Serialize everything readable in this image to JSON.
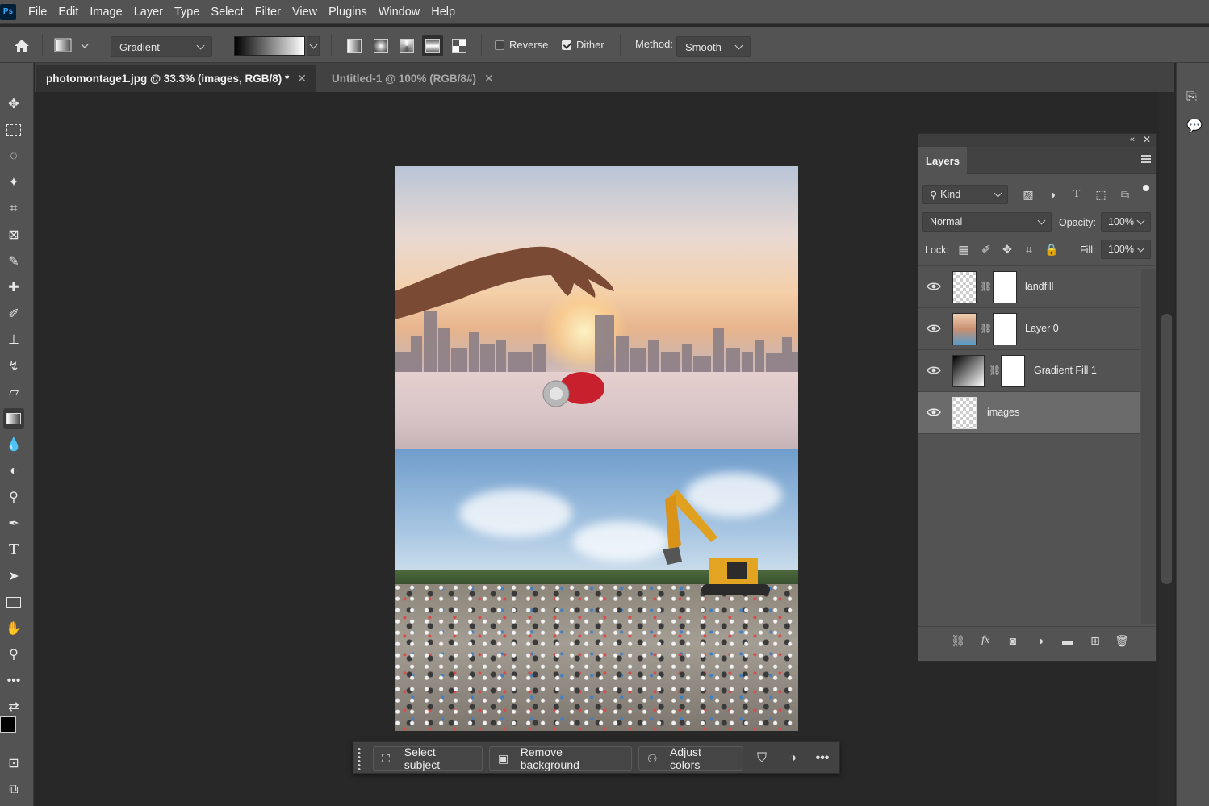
{
  "menubar": {
    "logo": "Ps",
    "items": [
      "File",
      "Edit",
      "Image",
      "Layer",
      "Type",
      "Select",
      "Filter",
      "View",
      "Plugins",
      "Window",
      "Help"
    ]
  },
  "options": {
    "preset_label": "Gradient",
    "reverse_label": "Reverse",
    "reverse_checked": false,
    "dither_label": "Dither",
    "dither_checked": true,
    "method_label": "Method:",
    "method_value": "Smooth"
  },
  "tabs": [
    {
      "label": "photomontage1.jpg @ 33.3% (images, RGB/8) *",
      "active": true
    },
    {
      "label": "Untitled-1 @ 100% (RGB/8#)",
      "active": false
    }
  ],
  "taskbar": {
    "select_subject": "Select subject",
    "remove_background": "Remove background",
    "adjust_colors": "Adjust colors"
  },
  "layers_panel": {
    "tab_label": "Layers",
    "filter_kind": "Kind",
    "blend_mode": "Normal",
    "opacity_label": "Opacity:",
    "opacity_value": "100%",
    "lock_label": "Lock:",
    "fill_label": "Fill:",
    "fill_value": "100%",
    "layers": [
      {
        "name": "landfill",
        "visible": true,
        "selected": false
      },
      {
        "name": "Layer 0",
        "visible": true,
        "selected": false
      },
      {
        "name": "Gradient Fill 1",
        "visible": true,
        "selected": false
      },
      {
        "name": "images",
        "visible": true,
        "selected": true
      }
    ]
  },
  "colors": {
    "ui_bg": "#535353",
    "canvas_bg": "#282828",
    "selected_layer": "#6b6b6b",
    "ps_blue": "#31a8ff"
  }
}
